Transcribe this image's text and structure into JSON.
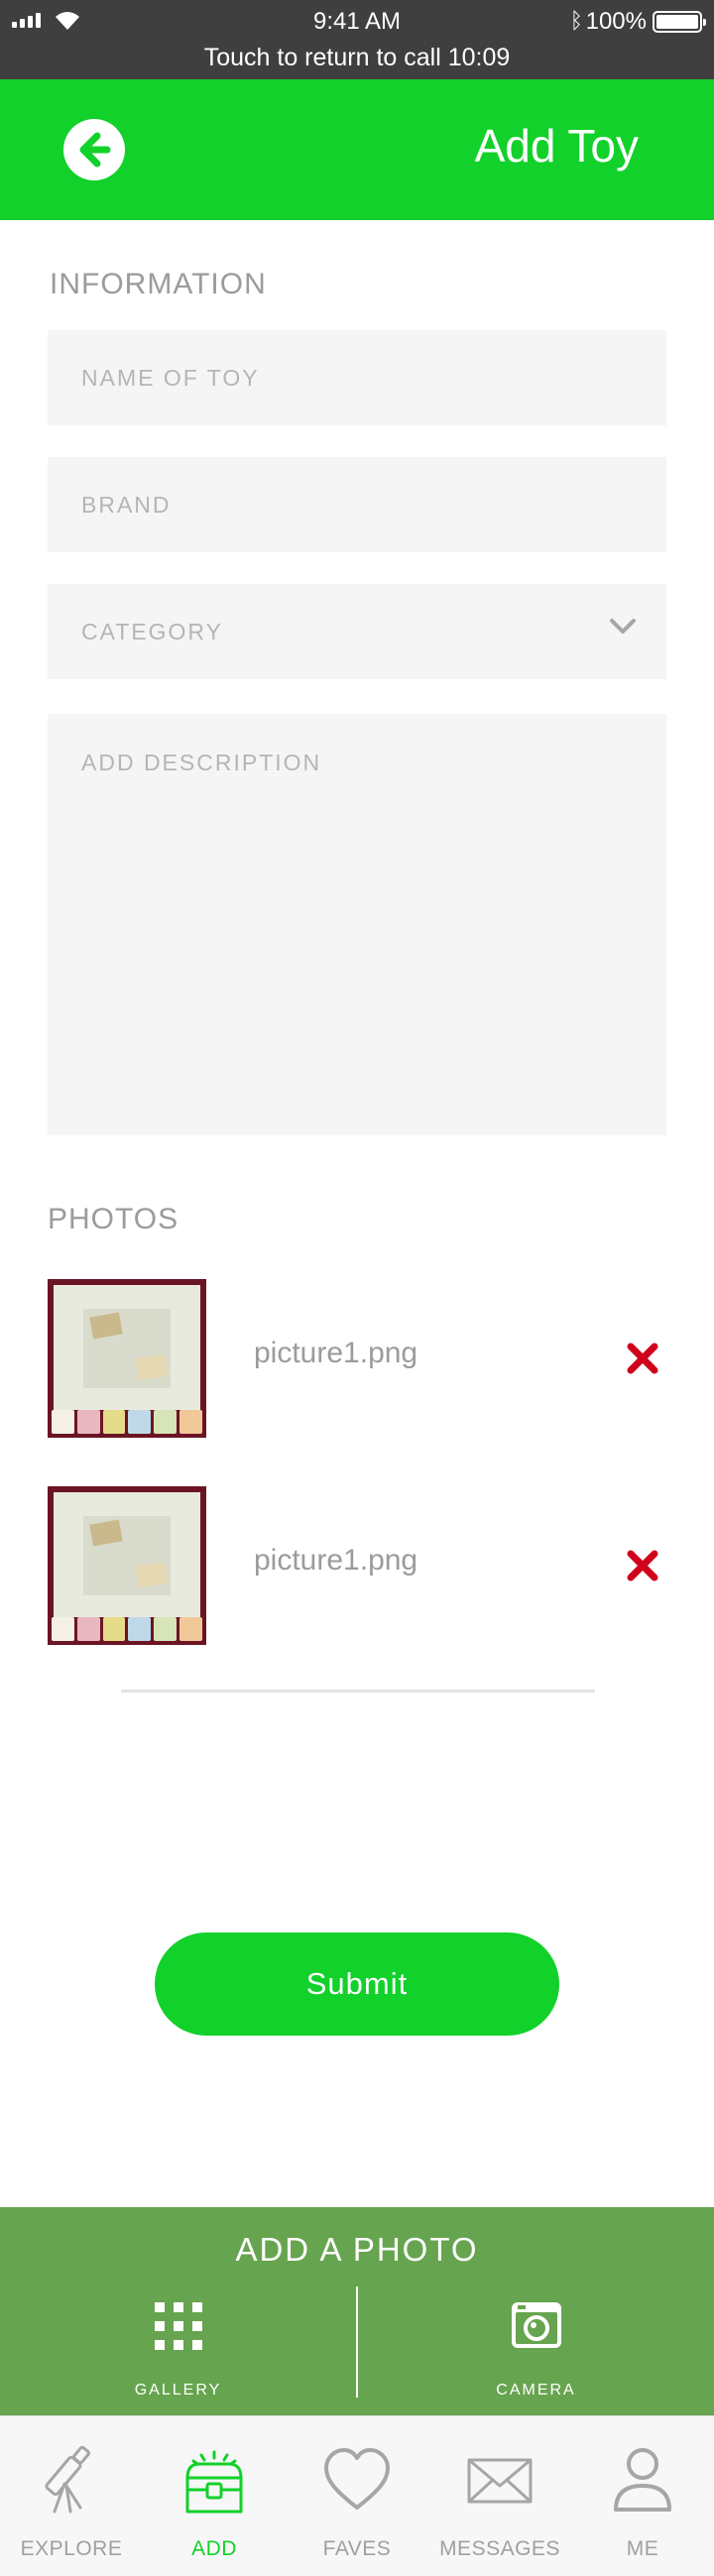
{
  "status_bar": {
    "time": "9:41 AM",
    "battery": "100%",
    "call_banner": "Touch to return to call 10:09",
    "icons": [
      "signal-icon",
      "wifi-icon",
      "bluetooth-icon",
      "battery-icon"
    ]
  },
  "header": {
    "title": "Add Toy",
    "back_icon": "arrow-left-circle-icon"
  },
  "information": {
    "label": "INFORMATION",
    "name_placeholder": "NAME OF TOY",
    "name_value": "",
    "brand_placeholder": "BRAND",
    "brand_value": "",
    "category_placeholder": "CATEGORY",
    "description_placeholder": "ADD DESCRIPTION",
    "description_value": ""
  },
  "photos": {
    "label": "PHOTOS",
    "items": [
      {
        "filename": "picture1.png",
        "remove_icon": "close-x-icon"
      },
      {
        "filename": "picture1.png",
        "remove_icon": "close-x-icon"
      }
    ]
  },
  "submit_label": "Submit",
  "add_photo": {
    "title": "ADD A PHOTO",
    "gallery_label": "GALLERY",
    "camera_label": "CAMERA"
  },
  "tabs": [
    {
      "label": "EXPLORE",
      "icon": "telescope-icon"
    },
    {
      "label": "ADD",
      "icon": "toy-chest-icon",
      "active": true
    },
    {
      "label": "FAVES",
      "icon": "heart-icon"
    },
    {
      "label": "MESSAGES",
      "icon": "envelope-icon"
    },
    {
      "label": "ME",
      "icon": "user-icon"
    }
  ],
  "colors": {
    "brand_green": "#12d12a",
    "panel_green": "#67a44f",
    "remove_red": "#d0021b",
    "status_bar": "#3f3f3f"
  }
}
